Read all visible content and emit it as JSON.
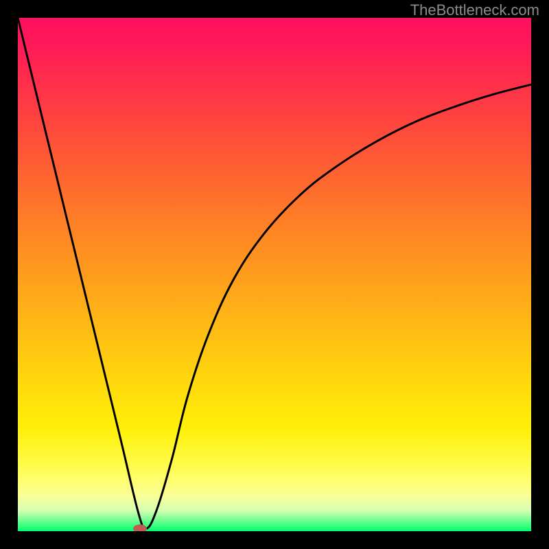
{
  "attribution": "TheBottleneck.com",
  "chart_data": {
    "type": "line",
    "title": "",
    "xlabel": "",
    "ylabel": "",
    "xlim": [
      0,
      100
    ],
    "ylim": [
      0,
      100
    ],
    "series": [
      {
        "name": "curve",
        "x": [
          0,
          5,
          10,
          15,
          20,
          23.5,
          25,
          27,
          30,
          33,
          37,
          42,
          48,
          55,
          62,
          70,
          78,
          86,
          93,
          100
        ],
        "values": [
          100,
          79.5,
          59.0,
          38.5,
          18.0,
          3.5,
          0.5,
          4.0,
          14.0,
          26.0,
          38.0,
          49.0,
          58.0,
          65.5,
          71.0,
          76.0,
          80.0,
          83.0,
          85.2,
          87.0
        ]
      }
    ],
    "marker": {
      "x": 23.8,
      "y": 0.5
    },
    "grid": false,
    "legend": false
  },
  "colors": {
    "frame": "#000000",
    "curve": "#000000",
    "marker": "#c05a52"
  }
}
